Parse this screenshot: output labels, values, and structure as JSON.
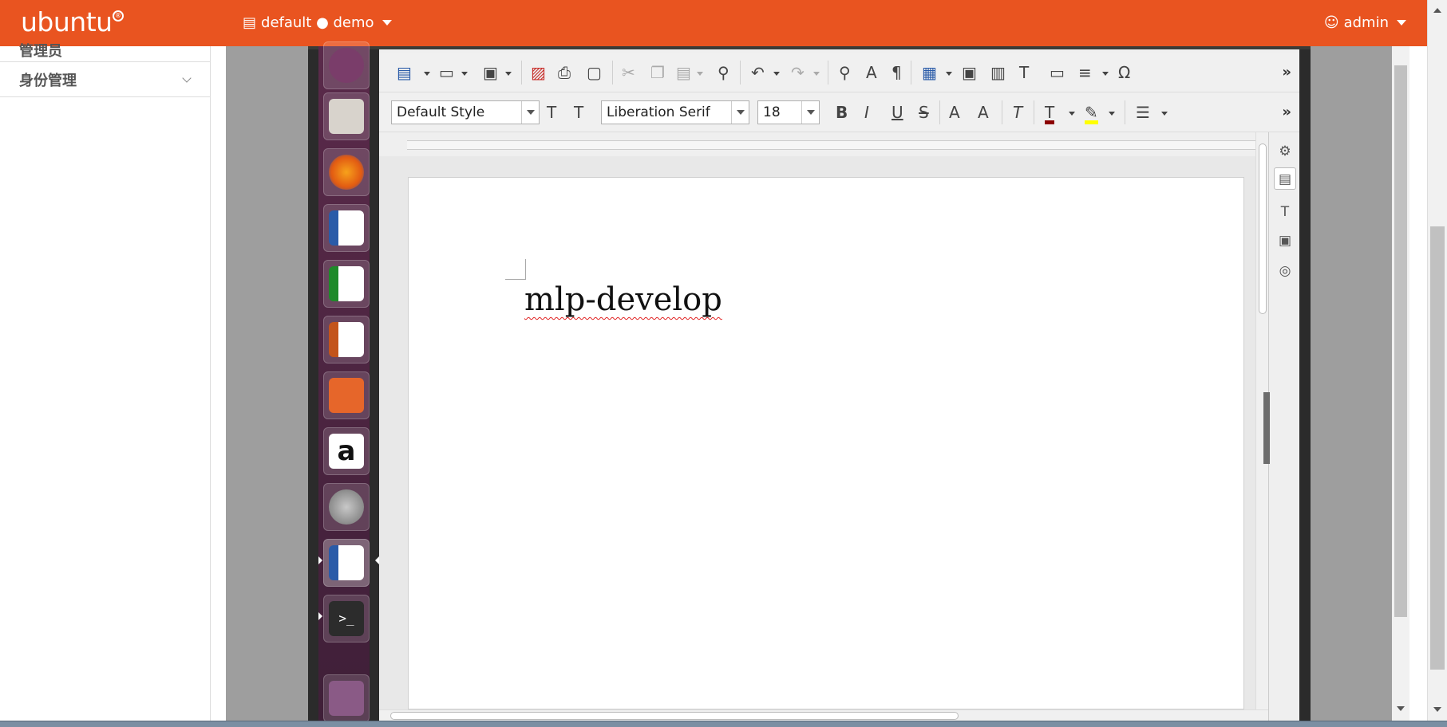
{
  "topbar": {
    "brand": "ubuntu",
    "brand_mark": "®",
    "session_icon": "list-icon",
    "session_label": "default ● demo",
    "admin_icon": "user-icon",
    "admin_label": "admin",
    "bg_color": "#e95420"
  },
  "sidebar": {
    "partial_item": "管理员",
    "identity_label": "身份管理"
  },
  "launcher": {
    "apps": [
      "dash-icon",
      "files-icon",
      "firefox-icon",
      "writer-icon",
      "calc-icon",
      "impress-icon",
      "software-center-icon",
      "amazon-icon",
      "system-settings-icon",
      "writer-open-icon",
      "terminal-icon",
      "trash-icon"
    ]
  },
  "writer": {
    "paragraph_style": "Default Style",
    "font_name": "Liberation Serif",
    "font_size": "18",
    "document_text": "mlp-develop"
  },
  "colors": {
    "font_color": "#8b0000",
    "highlight_color": "#ffff00"
  }
}
